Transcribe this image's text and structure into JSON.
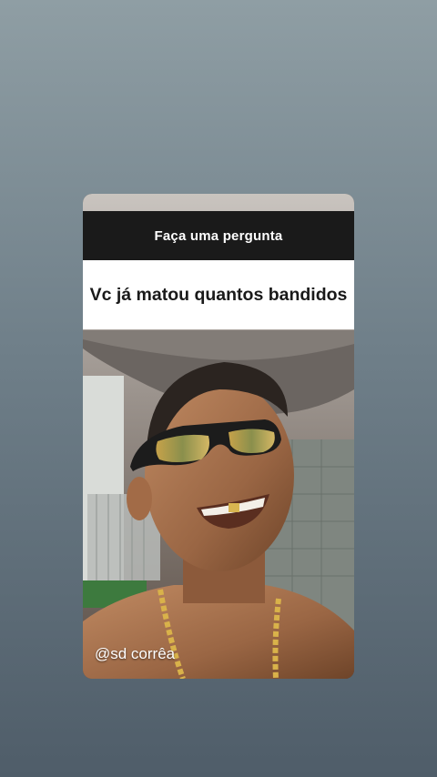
{
  "story": {
    "question_header": "Faça uma pergunta",
    "question_answer": "Vc já matou quantos bandidos",
    "mention": "@sd corrêa"
  }
}
